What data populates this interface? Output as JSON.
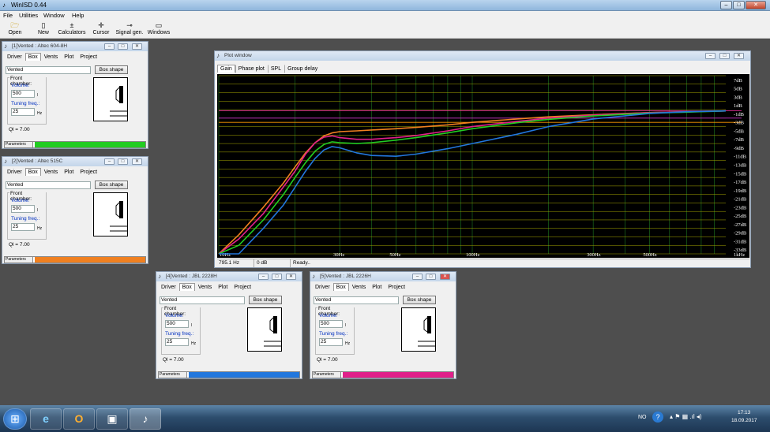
{
  "app": {
    "title": "WinISD 0.44",
    "window_buttons": [
      "–",
      "□",
      "✕"
    ]
  },
  "menu": [
    "File",
    "Utilities",
    "Window",
    "Help"
  ],
  "toolbar": [
    {
      "label": "Open",
      "icon": "folder-icon",
      "glyph": "🗁"
    },
    {
      "label": "New",
      "icon": "new-project-icon",
      "glyph": "▯"
    },
    {
      "label": "Calculators",
      "icon": "calculator-icon",
      "glyph": "±"
    },
    {
      "label": "Cursor",
      "icon": "cursor-icon",
      "glyph": "✛"
    },
    {
      "label": "Signal gen.",
      "icon": "signal-generator-icon",
      "glyph": "⊸"
    },
    {
      "label": "Windows",
      "icon": "windows-icon",
      "glyph": "▭"
    }
  ],
  "project_windows": [
    {
      "title": "[1]Vented : Altec 604-8H",
      "color": "#22cc22"
    },
    {
      "title": "[2]Vented : Altec 515C",
      "color": "#f08020"
    },
    {
      "title": "[4]Vented : JBL 2228H",
      "color": "#2277dd"
    },
    {
      "title": "[5]Vented : JBL 2226H",
      "color": "#e0208a"
    }
  ],
  "project_common": {
    "tabs": [
      "Driver",
      "Box",
      "Vents",
      "Plot",
      "Project"
    ],
    "active_tab": "Box",
    "box_type": "Vented",
    "box_shape_button": "Box shape",
    "group_label": "Front chamber:",
    "volume_label": "Volume:",
    "volume_value": "500",
    "volume_unit": "l",
    "tuning_label": "Tuning freq.:",
    "tuning_value": "25",
    "tuning_unit": "Hz",
    "ql": "Ql = 7.00",
    "parameters_label": "Parameters"
  },
  "plot_window": {
    "title": "Plot window",
    "tabs": [
      "Gain",
      "Phase plot",
      "SPL",
      "Group delay"
    ],
    "active_tab": "Gain",
    "status": {
      "freq": "795.1 Hz",
      "db": "0 dB",
      "msg": "Ready.."
    }
  },
  "chart_data": {
    "type": "line",
    "title": "",
    "xlabel": "",
    "ylabel": "",
    "x_scale": "log",
    "xlim": [
      10,
      1000
    ],
    "ylim": [
      -34,
      8
    ],
    "x_tick_labels": [
      "10Hz",
      "30Hz",
      "50Hz",
      "100Hz",
      "300Hz",
      "500Hz",
      "1kHz"
    ],
    "x_ticks": [
      10,
      30,
      50,
      100,
      300,
      500,
      1000
    ],
    "y_ticks": [
      7,
      5,
      3,
      1,
      -1,
      -3,
      -5,
      -7,
      -9,
      -11,
      -13,
      -15,
      -17,
      -19,
      -21,
      -23,
      -25,
      -27,
      -29,
      -31,
      -33
    ],
    "y_tick_labels": [
      "7dB",
      "5dB",
      "3dB",
      "1dB",
      "-1dB",
      "-3dB",
      "-5dB",
      "-7dB",
      "-9dB",
      "-11dB",
      "-13dB",
      "-15dB",
      "-17dB",
      "-19dB",
      "-21dB",
      "-23dB",
      "-25dB",
      "-27dB",
      "-29dB",
      "-31dB",
      "-33dB"
    ],
    "grid": true,
    "background": "#000000",
    "x": [
      10,
      12,
      15,
      18,
      20,
      22,
      24,
      26,
      28,
      30,
      35,
      40,
      50,
      60,
      80,
      100,
      150,
      200,
      300,
      500,
      700,
      1000
    ],
    "series": [
      {
        "color": "#f08020",
        "values": [
          -34,
          -29.5,
          -23,
          -17.3,
          -13.5,
          -10.2,
          -7.8,
          -6.2,
          -5.5,
          -5.2,
          -5,
          -4.8,
          -4.5,
          -4.2,
          -3.6,
          -3,
          -2.2,
          -1.7,
          -1.2,
          -0.7,
          -0.5,
          -0.3
        ]
      },
      {
        "color": "#e0208a",
        "values": [
          -34,
          -30.5,
          -24.5,
          -18.2,
          -14.5,
          -10.5,
          -7.8,
          -6.5,
          -6.2,
          -6.6,
          -7,
          -7,
          -6.6,
          -6.1,
          -5,
          -4,
          -2.8,
          -2,
          -1.3,
          -0.7,
          -0.5,
          -0.3
        ]
      },
      {
        "color": "#22cc22",
        "values": [
          -34,
          -32,
          -26,
          -20,
          -16,
          -12.5,
          -9.8,
          -8.2,
          -7.6,
          -7.8,
          -8,
          -7.8,
          -7.2,
          -6.6,
          -5.5,
          -4.5,
          -3.1,
          -2.3,
          -1.5,
          -0.8,
          -0.6,
          -0.3
        ]
      },
      {
        "color": "#2277dd",
        "values": [
          -34,
          -34,
          -28,
          -22.5,
          -18.3,
          -14.5,
          -11.5,
          -9.5,
          -8.7,
          -9,
          -10.2,
          -10.8,
          -11,
          -10.5,
          -9.2,
          -8,
          -5.8,
          -4,
          -2.2,
          -0.9,
          -0.5,
          -0.3
        ]
      }
    ],
    "reference_lines": [
      {
        "y": -0.3,
        "color": "#ff33aa"
      },
      {
        "y": -2,
        "color": "#cc33cc"
      },
      {
        "y": -3,
        "color": "#ff9900"
      }
    ]
  },
  "taskbar": {
    "apps": [
      {
        "icon": "start-orb-icon",
        "glyph": "⊞"
      },
      {
        "icon": "internet-explorer-icon",
        "glyph": "e"
      },
      {
        "icon": "outlook-icon",
        "glyph": "O"
      },
      {
        "icon": "project-icon",
        "glyph": "▣"
      },
      {
        "icon": "winisd-icon",
        "glyph": "♪"
      }
    ],
    "lang": "NO",
    "time": "17:13",
    "date": "18.09.2017"
  }
}
